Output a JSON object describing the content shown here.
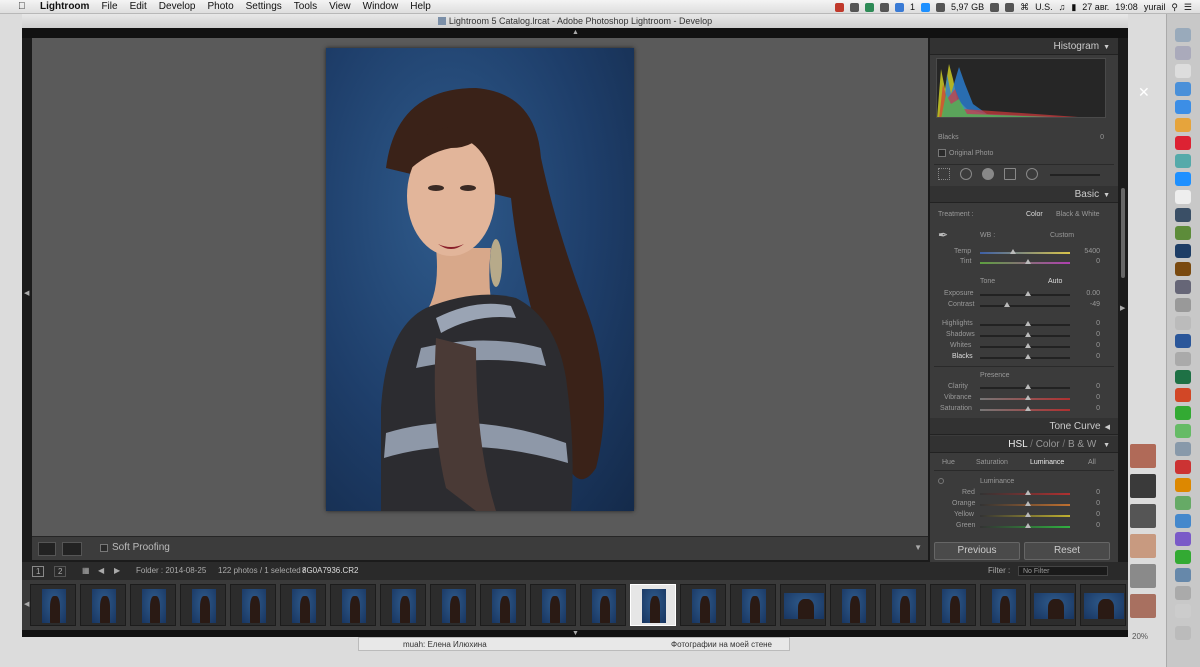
{
  "menubar": {
    "items": [
      "Lightroom",
      "File",
      "Edit",
      "Develop",
      "Photo",
      "Settings",
      "Tools",
      "View",
      "Window",
      "Help"
    ],
    "storage": "5,97 GB",
    "locale": "U.S.",
    "date": "27 авг.",
    "time": "19:08",
    "user": "yurail",
    "badge": "1"
  },
  "window": {
    "title": "Lightroom 5 Catalog.lrcat - Adobe Photoshop Lightroom - Develop"
  },
  "toolbar": {
    "soft_proofing": "Soft Proofing"
  },
  "right_panel": {
    "histogram": "Histogram",
    "blacks_readout": "Blacks",
    "blacks_readout_value": "0",
    "original_photo": "Original Photo",
    "basic": "Basic",
    "treatment": "Treatment :",
    "color": "Color",
    "bw": "Black & White",
    "wb": "WB :",
    "wb_value": "Custom",
    "temp": "Temp",
    "temp_value": "5400",
    "tint": "Tint",
    "tint_value": "0",
    "tone": "Tone",
    "auto": "Auto",
    "exposure": "Exposure",
    "exposure_value": "0.00",
    "contrast": "Contrast",
    "contrast_value": "-49",
    "highlights": "Highlights",
    "highlights_value": "0",
    "shadows": "Shadows",
    "shadows_value": "0",
    "whites": "Whites",
    "whites_value": "0",
    "blacks": "Blacks",
    "blacks_value": "0",
    "presence": "Presence",
    "clarity": "Clarity",
    "clarity_value": "0",
    "vibrance": "Vibrance",
    "vibrance_value": "0",
    "saturation": "Saturation",
    "saturation_value": "0",
    "tone_curve": "Tone Curve",
    "hsl": "HSL",
    "sep1": "/",
    "color_tab": "Color",
    "sep2": "/",
    "bw_tab": "B & W",
    "hue": "Hue",
    "sat_tab": "Saturation",
    "luminance": "Luminance",
    "all": "All",
    "luminance_head": "Luminance",
    "red": "Red",
    "red_value": "0",
    "orange": "Orange",
    "orange_value": "0",
    "yellow": "Yellow",
    "yellow_value": "0",
    "green": "Green",
    "green_value": "0",
    "previous": "Previous",
    "reset": "Reset"
  },
  "filmstrip_bar": {
    "page1": "1",
    "page2": "2",
    "folder": "Folder : 2014-08-25",
    "count": "122 photos / 1 selected /",
    "filename": "8G0A7936.CR2",
    "filter_label": "Filter :",
    "filter_value": "No Filter"
  },
  "taskbar": {
    "left": "muah: Елена Илюхина",
    "right": "Фотографии на моей стене"
  },
  "dock_percent": "20%",
  "colors": {
    "panel": "#3b3b3b",
    "main_bg": "#5a5a5a",
    "accent": "#2f5b8c"
  }
}
